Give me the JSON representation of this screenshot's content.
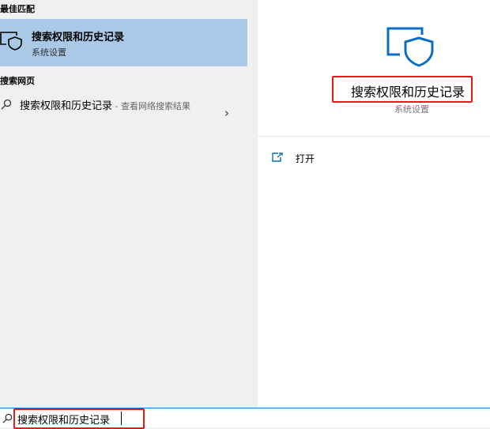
{
  "left_panel": {
    "best_match_label": "最佳匹配",
    "best_match": {
      "title": "搜索权限和历史记录",
      "subtitle": "系统设置",
      "icon": "shield-monitor-icon"
    },
    "web_label": "搜索网页",
    "web_item": {
      "title": "搜索权限和历史记录",
      "suffix": " - 查看网络搜索结果",
      "icon": "search-icon",
      "chevron": "›"
    }
  },
  "right_panel": {
    "title": "搜索权限和历史记录",
    "subtitle": "系统设置",
    "icon": "shield-monitor-icon",
    "actions": [
      {
        "label": "打开",
        "icon": "open-window-icon"
      }
    ]
  },
  "search_bar": {
    "value": "搜索权限和历史记录",
    "icon": "search-icon"
  },
  "colors": {
    "highlight": "#a9c9e6",
    "annotation_red": "#e51b1b",
    "accent_blue": "#1a73c4"
  }
}
